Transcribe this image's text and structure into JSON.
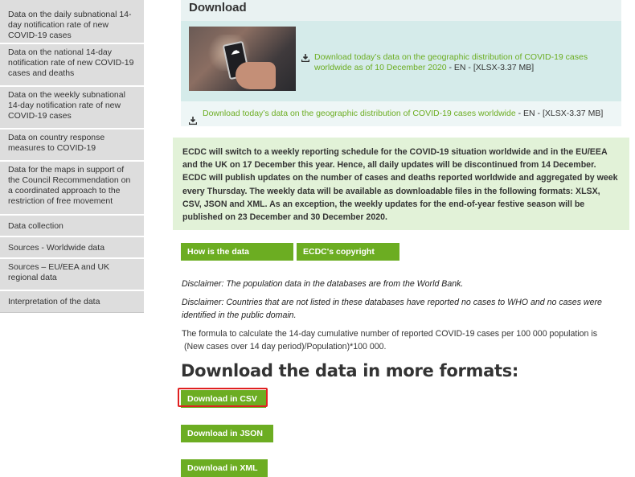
{
  "sidebar": {
    "items": [
      {
        "label": "Data on the daily subnational 14-day notification rate of new COVID-19 cases"
      },
      {
        "label": "Data on the national 14-day notification rate of new COVID-19 cases and deaths"
      },
      {
        "label": "Data on the weekly subnational 14-day notification rate of new COVID-19 cases"
      },
      {
        "label": "Data on country response measures to COVID-19"
      },
      {
        "label": "Data for the maps in support of the Council Recommendation on a coordinated approach to the restriction of free movement"
      },
      {
        "label": "Data collection"
      },
      {
        "label": "Sources - Worldwide data"
      },
      {
        "label": "Sources – EU/EEA and UK regional data"
      },
      {
        "label": "Interpretation of the data"
      }
    ]
  },
  "download_box": {
    "title": "Download",
    "feature_link": "Download today’s data on the geographic distribution of COVID-19 cases worldwide as of 10 December 2020",
    "feature_meta": " - EN - [XLSX-3.37 MB]",
    "row_link": "Download today’s data on the geographic distribution of COVID-19 cases worldwide",
    "row_meta": " - EN - [XLSX-3.37 MB]"
  },
  "notice": {
    "text": "ECDC will switch to a weekly reporting schedule for the COVID-19 situation worldwide and in the EU/EEA and the UK on 17 December this year. Hence, all daily updates will be discontinued from 14 December. ECDC will publish updates on the number of cases and deaths reported worldwide and aggregated by week every Thursday. The weekly data will be available as downloadable files in the following formats: XLSX, CSV, JSON and XML. As an exception, the weekly updates for the end-of-year festive season will be published on 23 December and 30 December 2020."
  },
  "buttons": {
    "how_collected": "How is the data collected?",
    "copyright": "ECDC's copyright policy",
    "csv": "Download in CSV",
    "json": "Download in JSON",
    "xml": "Download in XML"
  },
  "disclaimers": {
    "population": "Disclaimer: The population data in the databases are from the World Bank.",
    "countries": "Disclaimer: Countries that are not listed in these databases have reported no cases to WHO and no cases were identified in the public domain."
  },
  "formula": {
    "line1": "The formula to calculate the 14-day cumulative number of reported COVID-19 cases per 100 000 population is",
    "line2": "(New cases over 14 day period)/Population)*100 000."
  },
  "more_formats_heading": "Download the data in more formats:",
  "colors": {
    "accent_green": "#6cad22",
    "notice_bg": "#e2f2d8",
    "download_bg": "#d5ebea",
    "highlight_red": "#e02020"
  }
}
